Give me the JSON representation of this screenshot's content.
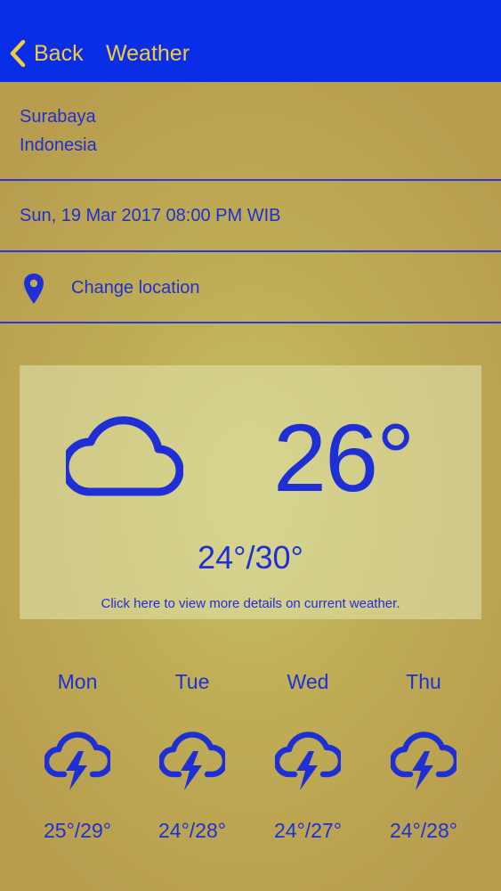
{
  "nav": {
    "back_label": "Back",
    "title": "Weather",
    "color": "#0a2ee8",
    "text_color": "#f2cc3b"
  },
  "location": {
    "city": "Surabaya",
    "country": "Indonesia"
  },
  "datetime": "Sun, 19 Mar 2017 08:00 PM WIB",
  "change_location": {
    "icon": "map-pin-icon",
    "label": "Change location"
  },
  "current": {
    "icon": "cloud-icon",
    "temperature": "26°",
    "range": "24°/30°",
    "details_link": "Click here to view more details on current weather."
  },
  "forecast": [
    {
      "day": "Mon",
      "icon": "thunderstorm-icon",
      "range": "25°/29°"
    },
    {
      "day": "Tue",
      "icon": "thunderstorm-icon",
      "range": "24°/28°"
    },
    {
      "day": "Wed",
      "icon": "thunderstorm-icon",
      "range": "24°/27°"
    },
    {
      "day": "Thu",
      "icon": "thunderstorm-icon",
      "range": "24°/28°"
    }
  ],
  "colors": {
    "accent_text": "#1f2fd6",
    "background": "#bfae55"
  }
}
